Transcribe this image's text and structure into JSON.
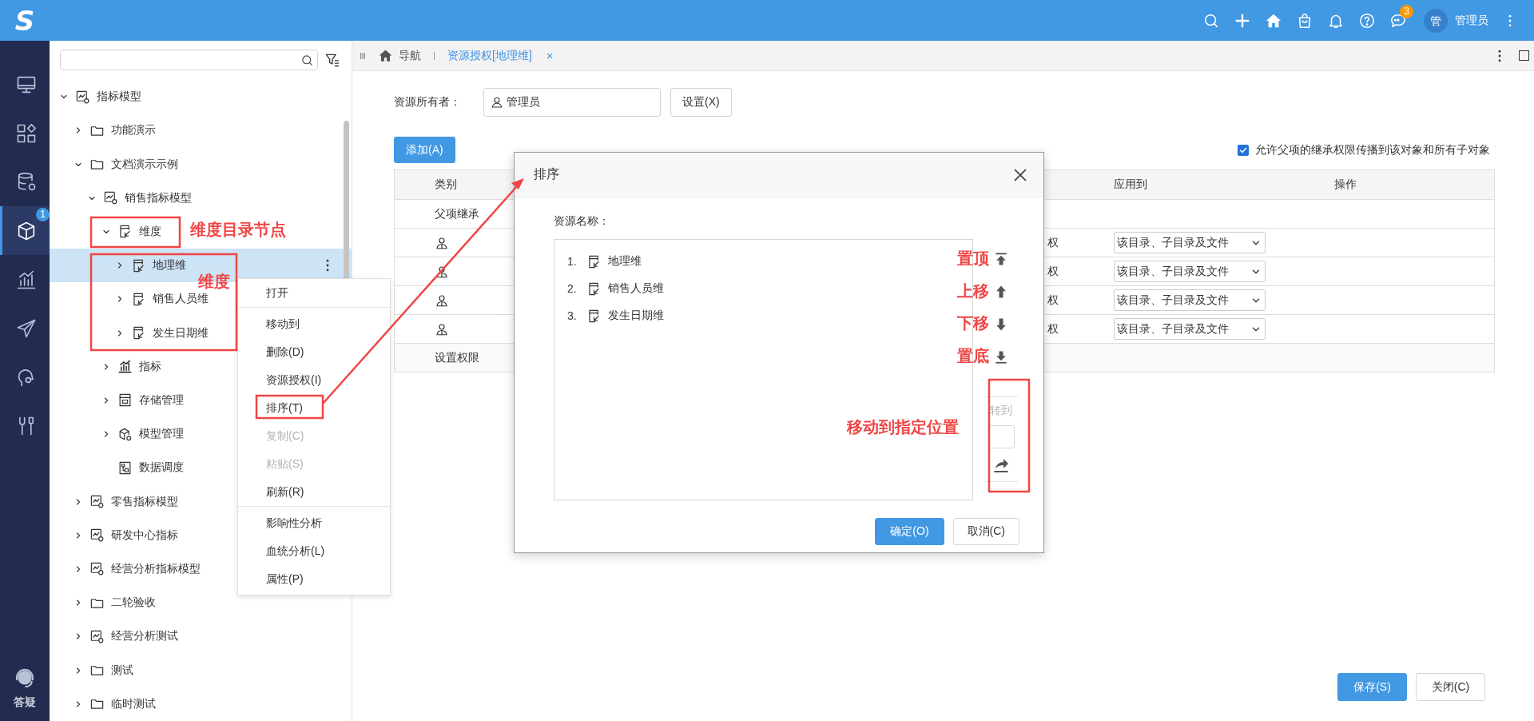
{
  "top_bar": {
    "logo": "S",
    "actions": [
      {
        "kind": "search"
      },
      {
        "kind": "plus"
      },
      {
        "kind": "home"
      },
      {
        "kind": "bag"
      },
      {
        "kind": "bell"
      },
      {
        "kind": "help"
      },
      {
        "kind": "chat",
        "badge": "3"
      }
    ],
    "avatar": "管",
    "user": "管理员"
  },
  "nav_rail": {
    "items": [
      {
        "kind": "monitor",
        "selected": false
      },
      {
        "kind": "widgets",
        "selected": false
      },
      {
        "kind": "database",
        "selected": false
      },
      {
        "kind": "cube",
        "selected": true,
        "badge": "1"
      },
      {
        "kind": "chart",
        "selected": false
      },
      {
        "kind": "plane",
        "selected": false
      },
      {
        "kind": "head",
        "selected": false
      },
      {
        "kind": "tools",
        "selected": false
      }
    ],
    "help": "答疑"
  },
  "tree": {
    "items": [
      {
        "label": "指标模型",
        "kind": "model",
        "expandable": true,
        "expanded": true,
        "selected": false,
        "children": [
          {
            "label": "功能演示",
            "kind": "folder",
            "expandable": true,
            "expanded": false,
            "selected": false
          },
          {
            "label": "文档演示示例",
            "kind": "folder",
            "expandable": true,
            "expanded": true,
            "selected": false,
            "children": [
              {
                "label": "销售指标模型",
                "kind": "model",
                "expandable": true,
                "expanded": true,
                "selected": false,
                "children": [
                  {
                    "label": "维度",
                    "kind": "dimension",
                    "expandable": true,
                    "expanded": true,
                    "selected": false,
                    "children": [
                      {
                        "label": "地理维",
                        "kind": "dimension",
                        "expandable": true,
                        "expanded": false,
                        "selected": true
                      },
                      {
                        "label": "销售人员维",
                        "kind": "dimension",
                        "expandable": true,
                        "expanded": false,
                        "selected": false
                      },
                      {
                        "label": "发生日期维",
                        "kind": "dimension",
                        "expandable": true,
                        "expanded": false,
                        "selected": false
                      }
                    ]
                  },
                  {
                    "label": "指标",
                    "kind": "metric",
                    "expandable": true,
                    "expanded": false,
                    "selected": false
                  },
                  {
                    "label": "存储管理",
                    "kind": "storage",
                    "expandable": true,
                    "expanded": false,
                    "selected": false
                  },
                  {
                    "label": "模型管理",
                    "kind": "cube",
                    "expandable": true,
                    "expanded": false,
                    "selected": false
                  },
                  {
                    "label": "数据调度",
                    "kind": "schedule",
                    "expandable": false,
                    "expanded": false,
                    "selected": false
                  }
                ]
              }
            ]
          },
          {
            "label": "零售指标模型",
            "kind": "model",
            "expandable": true,
            "expanded": false,
            "selected": false
          },
          {
            "label": "研发中心指标",
            "kind": "model",
            "expandable": true,
            "expanded": false,
            "selected": false
          },
          {
            "label": "经营分析指标模型",
            "kind": "model",
            "expandable": true,
            "expanded": false,
            "selected": false
          },
          {
            "label": "二轮验收",
            "kind": "folder",
            "expandable": true,
            "expanded": false,
            "selected": false
          },
          {
            "label": "经营分析测试",
            "kind": "model",
            "expandable": true,
            "expanded": false,
            "selected": false
          },
          {
            "label": "测试",
            "kind": "folder",
            "expandable": true,
            "expanded": false,
            "selected": false
          },
          {
            "label": "临时测试",
            "kind": "folder",
            "expandable": true,
            "expanded": false,
            "selected": false
          }
        ]
      }
    ]
  },
  "context_menu": [
    {
      "label": "打开",
      "disabled": false,
      "divider_after": true
    },
    {
      "label": "移动到",
      "disabled": false,
      "divider_after": false
    },
    {
      "label": "删除(D)",
      "disabled": false,
      "divider_after": false
    },
    {
      "label": "资源授权(I)",
      "disabled": false,
      "divider_after": false
    },
    {
      "label": "排序(T)",
      "disabled": false,
      "divider_after": false
    },
    {
      "label": "复制(C)",
      "disabled": true,
      "divider_after": false
    },
    {
      "label": "粘贴(S)",
      "disabled": true,
      "divider_after": false
    },
    {
      "label": "刷新(R)",
      "disabled": false,
      "divider_after": true
    },
    {
      "label": "影响性分析",
      "disabled": false,
      "divider_after": false
    },
    {
      "label": "血统分析(L)",
      "disabled": false,
      "divider_after": false
    },
    {
      "label": "属性(P)",
      "disabled": false,
      "divider_after": false
    }
  ],
  "tabs": [
    {
      "label": "导航",
      "kind": "home",
      "selected": false
    },
    {
      "label": "资源授权[地理维]",
      "kind": "page",
      "selected": true,
      "close": "×"
    }
  ],
  "owner": {
    "label": "资源所有者：",
    "value": "管理员",
    "button": "设置(X)"
  },
  "add_button": "添加(A)",
  "inherit_option": {
    "label": "允许父项的继承权限传播到该对象和所有子对象",
    "checked": true
  },
  "table": {
    "columns": [
      "类别",
      "应用到",
      "操作"
    ],
    "rows": [
      {
        "kind": "text",
        "category": "父项继承"
      },
      {
        "kind": "user",
        "column_3": "权",
        "apply_to": "该目录、子目录及文件"
      },
      {
        "kind": "user",
        "column_3": "权",
        "apply_to": "该目录、子目录及文件"
      },
      {
        "kind": "user",
        "column_3": "权",
        "apply_to": "该目录、子目录及文件"
      },
      {
        "kind": "user",
        "column_3": "权",
        "apply_to": "该目录、子目录及文件"
      },
      {
        "kind": "text",
        "category": "设置权限"
      }
    ]
  },
  "footer_buttons": [
    {
      "label": "保存(S)",
      "primary": true
    },
    {
      "label": "关闭(C)",
      "primary": false
    }
  ],
  "dialog": {
    "title": "排序",
    "field_label": "资源名称：",
    "items": [
      {
        "index": "1.",
        "label": "地理维"
      },
      {
        "index": "2.",
        "label": "销售人员维"
      },
      {
        "index": "3.",
        "label": "发生日期维"
      }
    ],
    "tools": [
      {
        "kind": "top"
      },
      {
        "kind": "up"
      },
      {
        "kind": "down"
      },
      {
        "kind": "bottom"
      }
    ],
    "goto": {
      "label": "转到",
      "disabled": true
    },
    "buttons": [
      {
        "label": "确定(O)",
        "primary": true
      },
      {
        "label": "取消(C)",
        "primary": false
      }
    ]
  },
  "annotations": [
    {
      "text": "维度目录节点"
    },
    {
      "text": "维度"
    },
    {
      "text": "置顶"
    },
    {
      "text": "上移"
    },
    {
      "text": "下移"
    },
    {
      "text": "置底"
    },
    {
      "text": "移动到指定位置"
    }
  ]
}
